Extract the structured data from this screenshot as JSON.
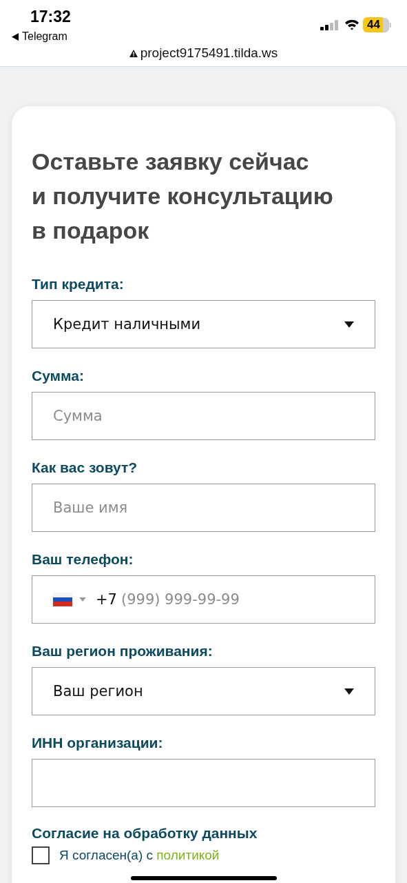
{
  "status_bar": {
    "time": "17:32",
    "back_label": "Telegram",
    "battery": "44"
  },
  "address_bar": {
    "url": "project9175491.tilda.ws"
  },
  "form": {
    "title_lines": [
      "Оставьте заявку сейчас",
      "и получите консультацию",
      "в подарок"
    ],
    "fields": [
      {
        "kind": "select",
        "label": "Тип кредита:",
        "value": "Кредит наличными"
      },
      {
        "kind": "text",
        "label": "Сумма:",
        "placeholder": "Сумма"
      },
      {
        "kind": "text",
        "label": "Как вас зовут?",
        "placeholder": "Ваше имя"
      },
      {
        "kind": "phone",
        "label": "Ваш телефон:",
        "prefix": "+7",
        "placeholder": "(999) 999-99-99"
      },
      {
        "kind": "select",
        "label": "Ваш регион проживания:",
        "value": "Ваш регион"
      },
      {
        "kind": "text",
        "label": "ИНН организации:"
      }
    ],
    "consent": {
      "heading": "Согласие на обработку данных",
      "checked": false,
      "text": "Я согласен(а) с",
      "link": "политикой"
    }
  }
}
